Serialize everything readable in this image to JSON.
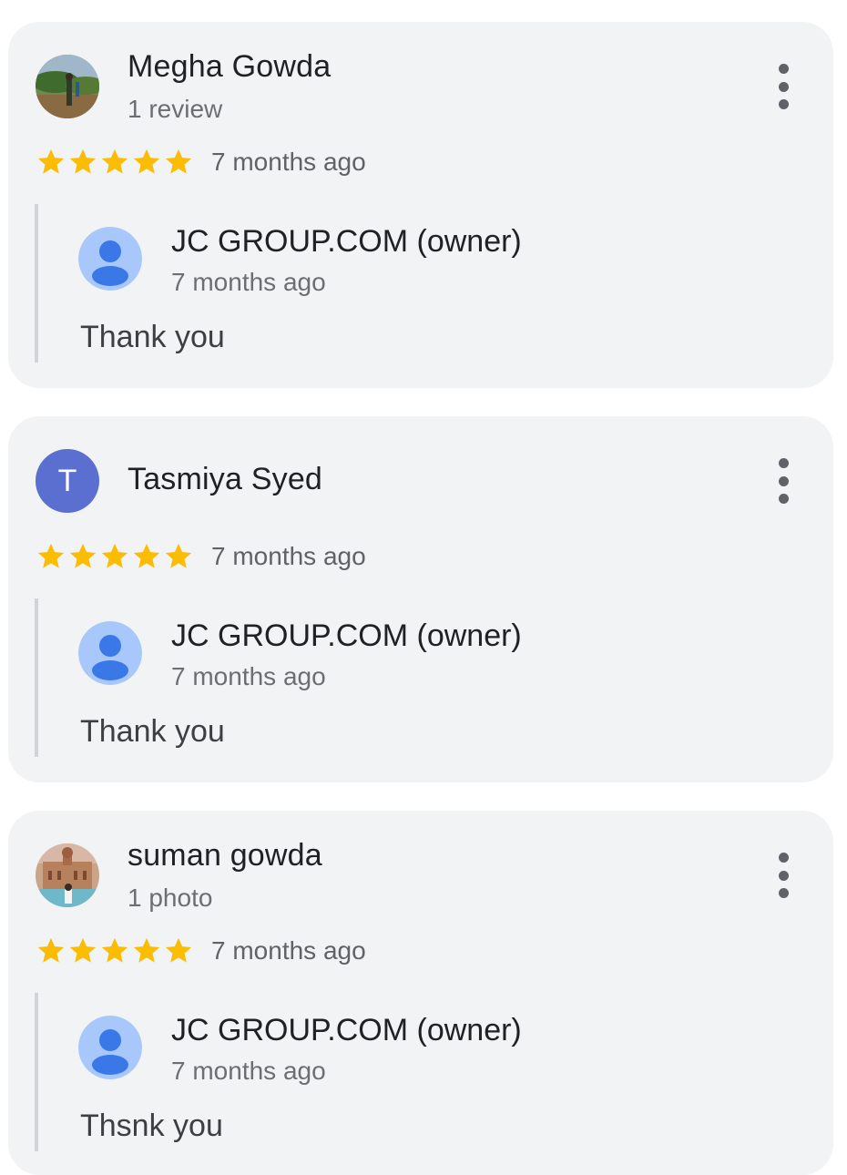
{
  "reviews": [
    {
      "reviewer": "Megha Gowda",
      "meta": "1 review",
      "avatar_type": "photo-landscape",
      "rating": 5,
      "date": "7 months ago",
      "reply": {
        "owner": "JC GROUP.COM (owner)",
        "date": "7 months ago",
        "text": "Thank you"
      }
    },
    {
      "reviewer": "Tasmiya Syed",
      "meta": "",
      "avatar_type": "letter",
      "avatar_letter": "T",
      "avatar_color": "#5a6fcf",
      "rating": 5,
      "date": "7 months ago",
      "reply": {
        "owner": "JC GROUP.COM (owner)",
        "date": "7 months ago",
        "text": "Thank you"
      }
    },
    {
      "reviewer": "suman gowda",
      "meta": "1 photo",
      "avatar_type": "photo-palace",
      "rating": 5,
      "date": "7 months ago",
      "reply": {
        "owner": "JC GROUP.COM (owner)",
        "date": "7 months ago",
        "text": "Thsnk you"
      }
    }
  ],
  "colors": {
    "star": "#fbbc04",
    "card_background": "#f2f3f5",
    "owner_avatar_bg": "#a8c7fa",
    "owner_avatar_fg": "#3b78e7"
  },
  "icons": {
    "more": "more-vert-icon",
    "star": "star-icon",
    "owner_avatar": "default-profile-icon"
  }
}
